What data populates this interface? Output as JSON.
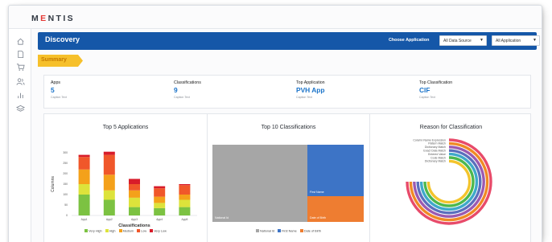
{
  "app": {
    "logo_pre": "M",
    "logo_accent": "E",
    "logo_post": "NTIS"
  },
  "sidebar": {
    "icons": [
      "home-icon",
      "document-icon",
      "cart-icon",
      "users-icon",
      "bar-chart-icon",
      "layers-icon"
    ]
  },
  "header": {
    "title": "Discovery",
    "choose_label": "Choose Application",
    "data_source_select": "All Data Source",
    "application_select": "All Application"
  },
  "summary": {
    "label": "Summary"
  },
  "kpis": [
    {
      "title": "Apps",
      "value": "5",
      "caption": "Caption Text"
    },
    {
      "title": "Classifications",
      "value": "9",
      "caption": "Caption Text"
    },
    {
      "title": "Top Application",
      "value": "PVH App",
      "caption": "Caption Text"
    },
    {
      "title": "Top Classification",
      "value": "CIF",
      "caption": "Caption Text"
    }
  ],
  "colors": {
    "header_blue": "#1557a8",
    "kpi_value_blue": "#1a73c9",
    "summary_tag": "#f6c02b"
  },
  "chart_data": [
    {
      "type": "bar",
      "stacked": true,
      "title": "Top 5 Applications",
      "xlabel": "Classifications",
      "ylabel": "Columns",
      "categories": [
        "App1",
        "App2",
        "App3",
        "App4",
        "App5"
      ],
      "yticks": [
        "0",
        "50",
        "100",
        "150",
        "200",
        "250",
        "300"
      ],
      "ylim": [
        0,
        300
      ],
      "grid": false,
      "legend_position": "bottom",
      "series": [
        {
          "name": "Very High",
          "color": "#7cc242",
          "values": [
            100,
            75,
            40,
            35,
            40
          ]
        },
        {
          "name": "High",
          "color": "#dde33b",
          "values": [
            50,
            45,
            45,
            25,
            35
          ]
        },
        {
          "name": "Medium",
          "color": "#f4a11a",
          "values": [
            70,
            75,
            35,
            30,
            25
          ]
        },
        {
          "name": "Low",
          "color": "#f0572a",
          "values": [
            60,
            95,
            30,
            40,
            45
          ]
        },
        {
          "name": "Very Low",
          "color": "#d81c2a",
          "values": [
            10,
            15,
            25,
            10,
            5
          ]
        }
      ]
    },
    {
      "type": "treemap",
      "title": "Top 10 Classifications",
      "legend_position": "bottom",
      "items": [
        {
          "name": "National Id",
          "color": "#a6a6a6",
          "value": 60
        },
        {
          "name": "First Name",
          "color": "#3d74c6",
          "value": 21
        },
        {
          "name": "Date of Birth",
          "color": "#ee7d31",
          "value": 19
        }
      ]
    },
    {
      "type": "radial_bar",
      "title": "Reason for Classification",
      "items": [
        {
          "name": "Column Name Expression",
          "color": "#e84b6a",
          "value": 100
        },
        {
          "name": "Pattern Match",
          "color": "#f08a24",
          "value": 100
        },
        {
          "name": "Dictionary Match",
          "color": "#9c5ab0",
          "value": 100
        },
        {
          "name": "Exact Data Match",
          "color": "#5b6fbd",
          "value": 100
        },
        {
          "name": "Entered Value",
          "color": "#3fa9c9",
          "value": 100
        },
        {
          "name": "Code Match",
          "color": "#4db84d",
          "value": 100
        },
        {
          "name": "Dictionary Match",
          "color": "#f3c42c",
          "value": 100
        }
      ]
    }
  ]
}
